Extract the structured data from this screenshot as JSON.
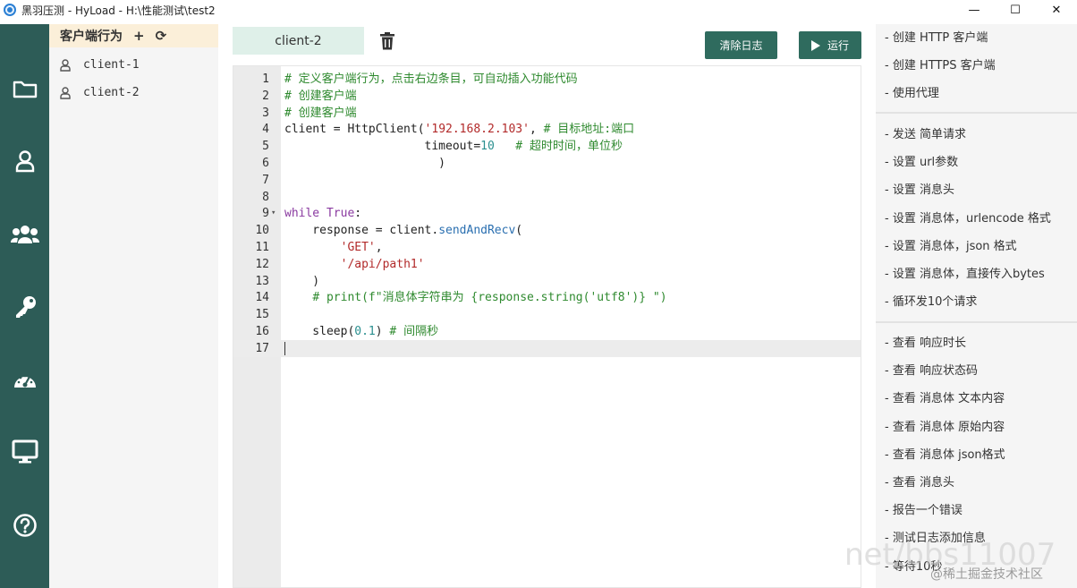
{
  "window": {
    "title": "黑羽压测 - HyLoad - H:\\性能测试\\test2",
    "controls": [
      "—",
      "☐",
      "✕"
    ]
  },
  "icons": {
    "nav": [
      "folder-icon",
      "user-icon",
      "users-icon",
      "key-icon",
      "speedometer-icon",
      "monitor-icon",
      "help-icon"
    ]
  },
  "client_panel": {
    "title": "客户端行为",
    "add_label": "+",
    "refresh_label": "⟳",
    "clients": [
      "client-1",
      "client-2"
    ]
  },
  "editor_tab": {
    "label": "client-2"
  },
  "toolbar": {
    "clear_log_label": "清除日志",
    "run_label": "运行"
  },
  "editor": {
    "line_numbers": [
      "1",
      "2",
      "3",
      "4",
      "5",
      "6",
      "7",
      "8",
      "9",
      "10",
      "11",
      "12",
      "13",
      "14",
      "15",
      "16",
      "17"
    ],
    "active_line": 17,
    "code": [
      "# 定义客户端行为，点击右边条目，可自动插入功能代码",
      "# 创建客户端",
      "# 创建客户端",
      "client = HttpClient('192.168.2.103', # 目标地址:端口",
      "                    timeout=10   # 超时时间，单位秒",
      "                      )",
      "",
      "",
      "while True:",
      "    response = client.sendAndRecv(",
      "        'GET',",
      "        '/api/path1'",
      "    )",
      "    # print(f\"消息体字符串为 {response.string('utf8')} \")",
      "",
      "    sleep(0.1) # 间隔秒",
      ""
    ]
  },
  "snippets": {
    "group1": [
      "- 创建 HTTP 客户端",
      "- 创建 HTTPS 客户端",
      "- 使用代理"
    ],
    "group2": [
      "- 发送 简单请求",
      "- 设置 url参数",
      "- 设置 消息头",
      "- 设置 消息体，urlencode 格式",
      "- 设置 消息体，json 格式",
      "- 设置 消息体，直接传入bytes",
      "- 循环发10个请求"
    ],
    "group3": [
      "- 查看 响应时长",
      "- 查看 响应状态码",
      "- 查看 消息体 文本内容",
      "- 查看 消息体 原始内容",
      "- 查看 消息体 json格式",
      "- 查看 消息头",
      "- 报告一个错误",
      "- 测试日志添加信息",
      "- 等待10秒"
    ]
  },
  "watermark": {
    "text": "@稀土掘金技术社区",
    "overlay": "net/bbs11007"
  }
}
